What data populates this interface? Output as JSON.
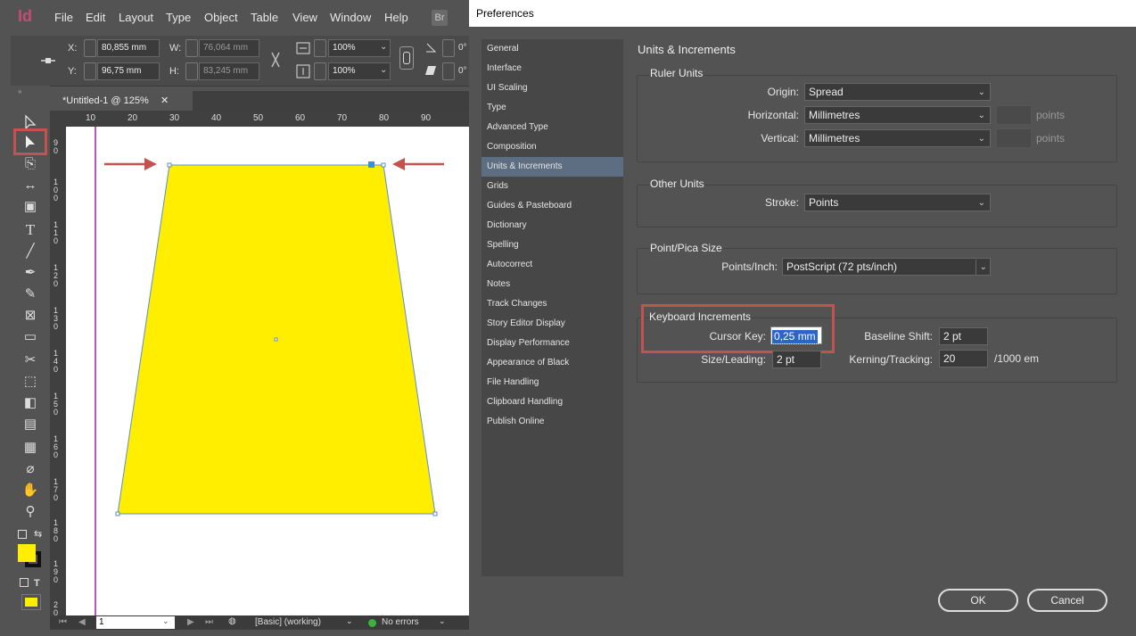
{
  "app": {
    "logo": "Id",
    "menus": [
      "File",
      "Edit",
      "Layout",
      "Type",
      "Object",
      "Table",
      "View",
      "Window",
      "Help"
    ],
    "bridge": "Br",
    "control": {
      "x_label": "X:",
      "x_value": "80,855 mm",
      "y_label": "Y:",
      "y_value": "96,75 mm",
      "w_label": "W:",
      "w_value": "76,064 mm",
      "h_label": "H:",
      "h_value": "83,245 mm",
      "scale_x": "100%",
      "scale_y": "100%",
      "angle_partial": "0°",
      "shear_partial": "0°"
    },
    "doc_tab": "*Untitled-1 @ 125%",
    "doc_tab_close": "✕",
    "hruler": [
      "10",
      "20",
      "30",
      "40",
      "50",
      "60",
      "70",
      "80",
      "90"
    ],
    "vruler": [
      "90",
      "100",
      "110",
      "120",
      "130",
      "140",
      "150",
      "160",
      "170",
      "180",
      "190",
      "20"
    ],
    "status": {
      "page": "1",
      "style": "[Basic] (working)",
      "errors": "No errors"
    },
    "colors": {
      "shape_fill": "#ffee00",
      "arrow": "#c4524e",
      "guide": "#a020a0",
      "fill_swatch": "#ffee00"
    }
  },
  "dialog": {
    "title": "Preferences",
    "nav": [
      "General",
      "Interface",
      "UI Scaling",
      "Type",
      "Advanced Type",
      "Composition",
      "Units & Increments",
      "Grids",
      "Guides & Pasteboard",
      "Dictionary",
      "Spelling",
      "Autocorrect",
      "Notes",
      "Track Changes",
      "Story Editor Display",
      "Display Performance",
      "Appearance of Black",
      "File Handling",
      "Clipboard Handling",
      "Publish Online"
    ],
    "selected_nav": "Units & Increments",
    "heading": "Units & Increments",
    "ruler_units": {
      "title": "Ruler Units",
      "origin_label": "Origin:",
      "origin_value": "Spread",
      "horizontal_label": "Horizontal:",
      "horizontal_value": "Millimetres",
      "horizontal_unit": "points",
      "vertical_label": "Vertical:",
      "vertical_value": "Millimetres",
      "vertical_unit": "points"
    },
    "other_units": {
      "title": "Other Units",
      "stroke_label": "Stroke:",
      "stroke_value": "Points"
    },
    "point_pica": {
      "title": "Point/Pica Size",
      "points_label": "Points/Inch:",
      "points_value": "PostScript (72 pts/inch)"
    },
    "keyboard": {
      "title": "Keyboard Increments",
      "cursor_label": "Cursor Key:",
      "cursor_value": "0,25 mm",
      "size_label": "Size/Leading:",
      "size_value": "2 pt",
      "baseline_label": "Baseline Shift:",
      "baseline_value": "2 pt",
      "kerning_label": "Kerning/Tracking:",
      "kerning_value": "20",
      "kerning_unit": "/1000 em"
    },
    "ok": "OK",
    "cancel": "Cancel",
    "colors": {
      "highlight": "#c4524e",
      "selection": "#5d6d82"
    }
  }
}
